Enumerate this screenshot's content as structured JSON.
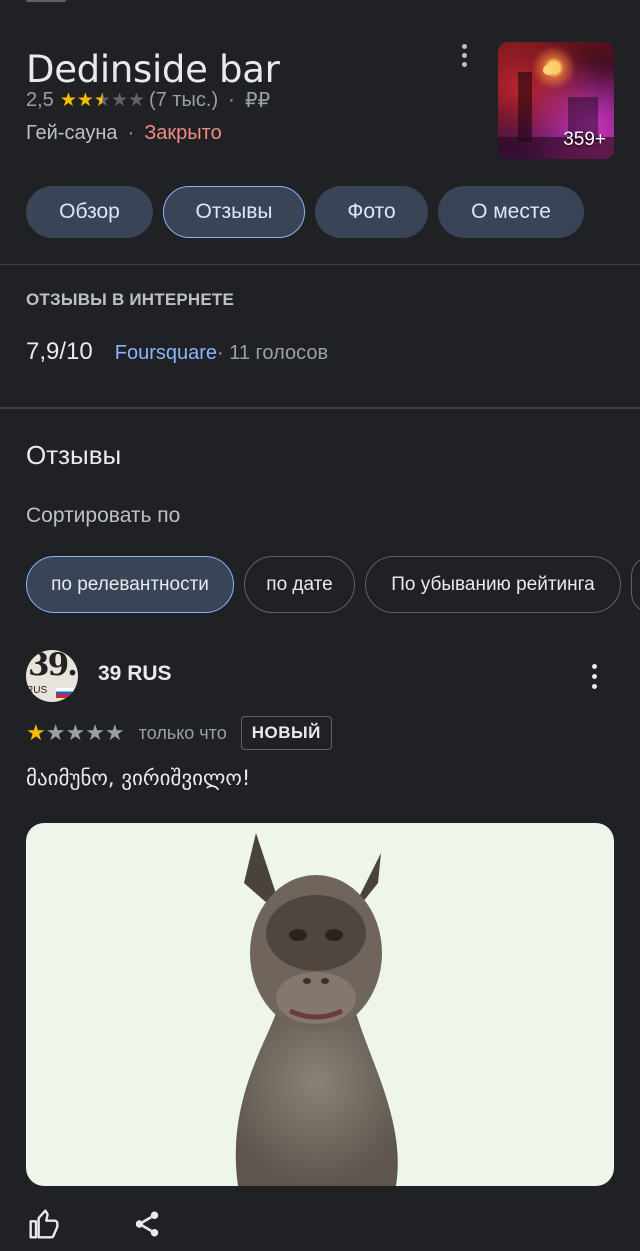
{
  "place": {
    "title": "Dedinside bar",
    "rating": "2,5",
    "stars": 2.5,
    "review_count": "(7 тыс.)",
    "price": "₽₽",
    "category": "Гей-сауна",
    "status": "Закрыто",
    "photo_count": "359+"
  },
  "tabs": [
    {
      "label": "Обзор",
      "active": false
    },
    {
      "label": "Отзывы",
      "active": true
    },
    {
      "label": "Фото",
      "active": false
    },
    {
      "label": "О месте",
      "active": false
    }
  ],
  "web_reviews": {
    "heading": "ОТЗЫВЫ В ИНТЕРНЕТЕ",
    "score": "7,9/10",
    "source": "Foursquare",
    "votes": "· 11 голосов"
  },
  "reviews": {
    "title": "Отзывы",
    "sort_label": "Сортировать по",
    "sort_options": [
      {
        "label": "по релевантности",
        "active": true
      },
      {
        "label": "по дате",
        "active": false
      },
      {
        "label": "По убыванию рейтинга",
        "active": false
      }
    ],
    "items": [
      {
        "avatar_text": "39.",
        "avatar_subtext": "RUS",
        "author": "39 RUS",
        "stars": 1,
        "time": "только что",
        "badge": "НОВЫЙ",
        "text": "მაიმუნო, ვირიშვილო!"
      }
    ]
  },
  "colors": {
    "background": "#202124",
    "accent": "#8ab4f8",
    "star": "#fbbc04",
    "closed": "#f28b82",
    "chip_active": "#394457"
  },
  "icons": [
    "more-vert-icon",
    "star-icon",
    "thumb-up-icon",
    "share-icon"
  ]
}
